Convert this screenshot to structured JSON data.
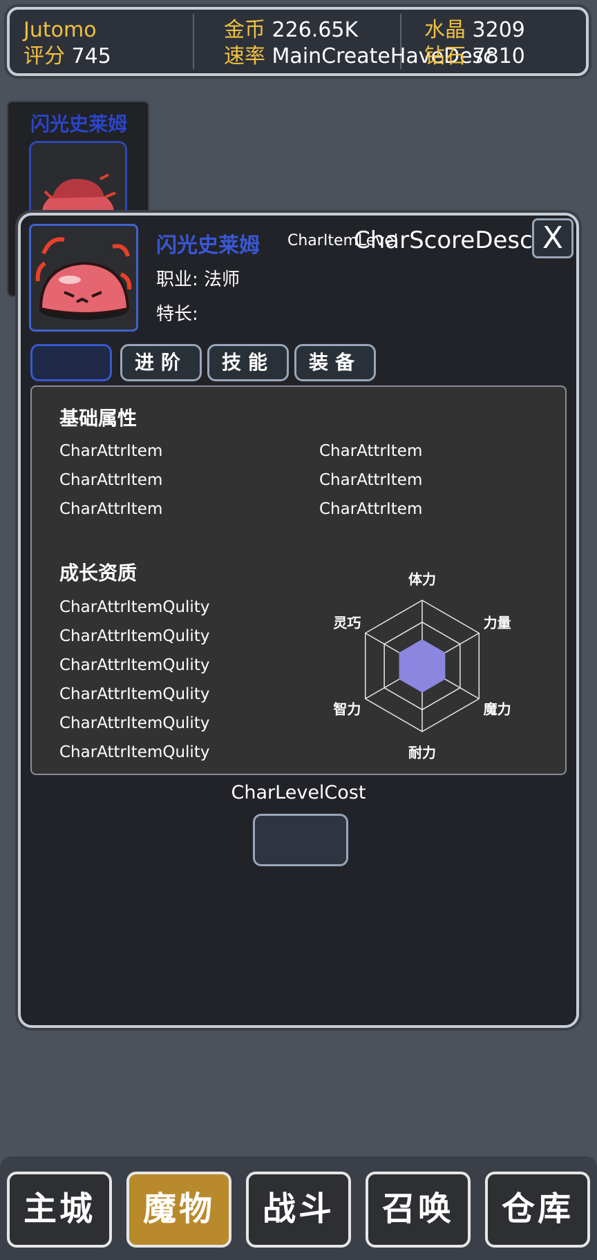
{
  "header": {
    "player_name": "Jutomo",
    "score_label": "评分",
    "score_value": "745",
    "gold_label": "金币",
    "gold_value": "226.65K",
    "rate_label": "速率",
    "rate_value": "MainCreateHaveDesc",
    "crystal_label": "水晶",
    "crystal_value": "3209",
    "extra_label": "钻石",
    "extra_value": "7810"
  },
  "card": {
    "name": "闪光史莱姆"
  },
  "dialog": {
    "char_name": "闪光史莱姆",
    "char_level": "CharItemLevel",
    "char_score": "CharScoreDesc",
    "close_label": "X",
    "job_label": "职业:",
    "job_value": "法师",
    "specialty_label": "特长:",
    "specialty_value": "",
    "tabs": [
      {
        "label": ""
      },
      {
        "label": "进阶"
      },
      {
        "label": "技能"
      },
      {
        "label": "装备"
      }
    ],
    "basic_title": "基础属性",
    "basic_attrs": [
      "CharAttrItem",
      "CharAttrItem",
      "CharAttrItem",
      "CharAttrItem",
      "CharAttrItem",
      "CharAttrItem"
    ],
    "growth_title": "成长资质",
    "growth_attrs": [
      "CharAttrItemQulity",
      "CharAttrItemQulity",
      "CharAttrItemQulity",
      "CharAttrItemQulity",
      "CharAttrItemQulity",
      "CharAttrItemQulity"
    ],
    "radar": {
      "axes": [
        "体力",
        "力量",
        "魔力",
        "耐力",
        "智力",
        "灵巧"
      ],
      "values": [
        0.4,
        0.4,
        0.4,
        0.4,
        0.4,
        0.4
      ],
      "fill_color": "#8c86e0"
    },
    "cost_label": "CharLevelCost"
  },
  "nav": {
    "items": [
      {
        "label": "主城"
      },
      {
        "label": "魔物"
      },
      {
        "label": "战斗"
      },
      {
        "label": "召唤"
      },
      {
        "label": "仓库"
      }
    ],
    "active_index": 1,
    "active_color": "#b98a2c"
  }
}
